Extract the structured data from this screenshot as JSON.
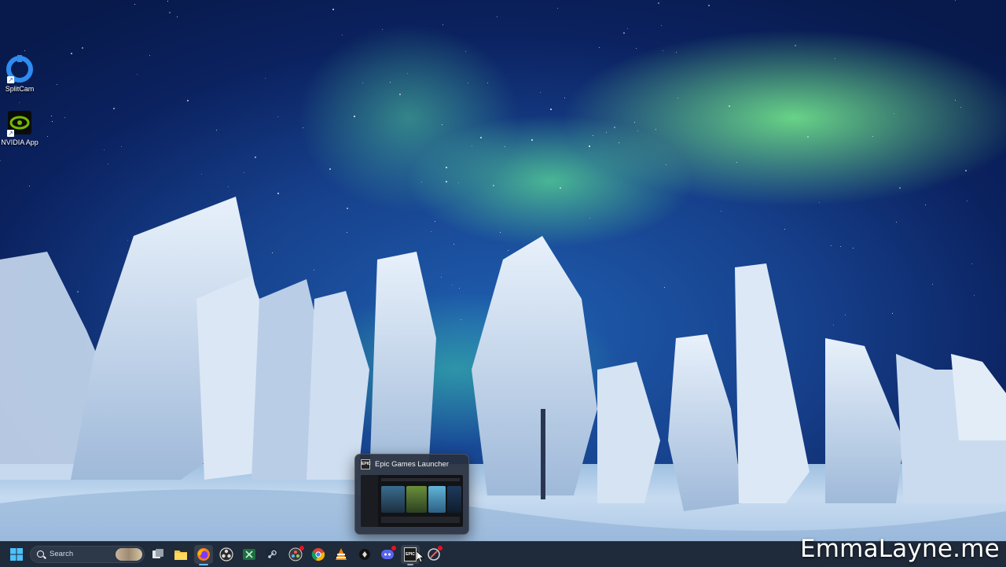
{
  "desktop": {
    "icons": [
      {
        "label": "SplitCam",
        "icon": "splitcam-icon"
      },
      {
        "label": "NVIDIA App",
        "icon": "nvidia-icon"
      }
    ]
  },
  "preview": {
    "title": "Epic Games Launcher",
    "app_icon_text": "EPIC"
  },
  "taskbar": {
    "search_label": "Search",
    "apps": [
      {
        "name": "start",
        "icon": "windows-start-icon"
      },
      {
        "name": "task-view",
        "icon": "task-view-icon"
      },
      {
        "name": "file-explorer",
        "icon": "folder-icon"
      },
      {
        "name": "firefox",
        "icon": "firefox-icon",
        "active": true
      },
      {
        "name": "obs",
        "icon": "obs-icon"
      },
      {
        "name": "excel",
        "icon": "excel-icon"
      },
      {
        "name": "steam",
        "icon": "steam-icon"
      },
      {
        "name": "davinci",
        "icon": "davinci-resolve-icon",
        "badge": true
      },
      {
        "name": "chrome",
        "icon": "chrome-icon"
      },
      {
        "name": "vlc",
        "icon": "vlc-icon"
      },
      {
        "name": "app-dark",
        "icon": "app-dark-icon"
      },
      {
        "name": "discord",
        "icon": "discord-icon",
        "badge": true
      },
      {
        "name": "epic",
        "icon": "epic-games-icon",
        "active": true,
        "hovered": true
      },
      {
        "name": "snip",
        "icon": "snipping-tool-icon",
        "badge": true
      }
    ],
    "epic_icon_text": "EPIC"
  },
  "watermark": "EmmaLayne.me",
  "colors": {
    "taskbar_bg": "#1f2a3a",
    "accent": "#6cb8ff",
    "badge": "#e81123"
  }
}
